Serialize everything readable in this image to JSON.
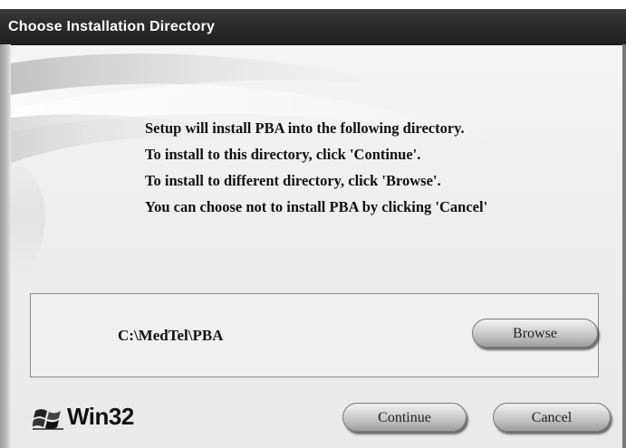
{
  "window": {
    "title": "Choose Installation Directory"
  },
  "message": {
    "line1": "Setup will install PBA into the following directory.",
    "line2": "To install to this directory, click 'Continue'.",
    "line3": "To install to different directory, click 'Browse'.",
    "line4": "You can choose not to install PBA by clicking 'Cancel'"
  },
  "path_panel": {
    "path": "C:\\MedTel\\PBA",
    "browse_label": "Browse"
  },
  "footer": {
    "logo_text": "Win32",
    "continue_label": "Continue",
    "cancel_label": "Cancel"
  },
  "colors": {
    "titlebar": "#2b2b2b",
    "title_text": "#ffffff",
    "background": "#ececec"
  },
  "icons": {
    "logo": "windows-flag-icon"
  }
}
